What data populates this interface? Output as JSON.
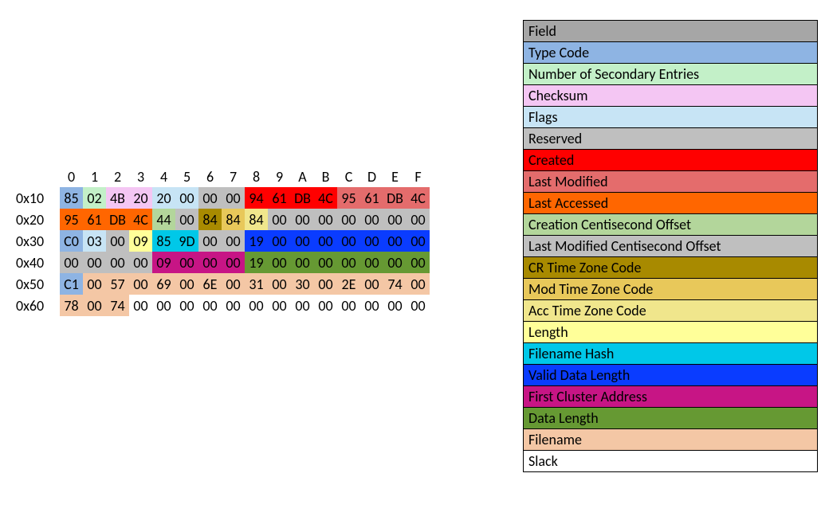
{
  "hex": {
    "col_headers": [
      "0",
      "1",
      "2",
      "3",
      "4",
      "5",
      "6",
      "7",
      "8",
      "9",
      "A",
      "B",
      "C",
      "D",
      "E",
      "F"
    ],
    "rows": [
      {
        "label": "0x10",
        "cells": [
          {
            "v": "85",
            "c": "c-typecode"
          },
          {
            "v": "02",
            "c": "c-numse"
          },
          {
            "v": "4B",
            "c": "c-checksum"
          },
          {
            "v": "20",
            "c": "c-checksum"
          },
          {
            "v": "20",
            "c": "c-flags"
          },
          {
            "v": "00",
            "c": "c-flags"
          },
          {
            "v": "00",
            "c": "c-reserved"
          },
          {
            "v": "00",
            "c": "c-reserved"
          },
          {
            "v": "94",
            "c": "c-created"
          },
          {
            "v": "61",
            "c": "c-created"
          },
          {
            "v": "DB",
            "c": "c-created"
          },
          {
            "v": "4C",
            "c": "c-created"
          },
          {
            "v": "95",
            "c": "c-lastmod"
          },
          {
            "v": "61",
            "c": "c-lastmod"
          },
          {
            "v": "DB",
            "c": "c-lastmod"
          },
          {
            "v": "4C",
            "c": "c-lastmod"
          }
        ]
      },
      {
        "label": "0x20",
        "cells": [
          {
            "v": "95",
            "c": "c-lastacc"
          },
          {
            "v": "61",
            "c": "c-lastacc"
          },
          {
            "v": "DB",
            "c": "c-lastacc"
          },
          {
            "v": "4C",
            "c": "c-lastacc"
          },
          {
            "v": "44",
            "c": "c-crcenti"
          },
          {
            "v": "00",
            "c": "c-lmcenti"
          },
          {
            "v": "84",
            "c": "c-crtz"
          },
          {
            "v": "84",
            "c": "c-modtz"
          },
          {
            "v": "84",
            "c": "c-acctz"
          },
          {
            "v": "00",
            "c": "c-reserved"
          },
          {
            "v": "00",
            "c": "c-reserved"
          },
          {
            "v": "00",
            "c": "c-reserved"
          },
          {
            "v": "00",
            "c": "c-reserved"
          },
          {
            "v": "00",
            "c": "c-reserved"
          },
          {
            "v": "00",
            "c": "c-reserved"
          },
          {
            "v": "00",
            "c": "c-reserved"
          }
        ]
      },
      {
        "label": "0x30",
        "cells": [
          {
            "v": "C0",
            "c": "c-typecode"
          },
          {
            "v": "03",
            "c": "c-flags"
          },
          {
            "v": "00",
            "c": "c-reserved"
          },
          {
            "v": "09",
            "c": "c-length"
          },
          {
            "v": "85",
            "c": "c-fhash"
          },
          {
            "v": "9D",
            "c": "c-fhash"
          },
          {
            "v": "00",
            "c": "c-reserved"
          },
          {
            "v": "00",
            "c": "c-reserved"
          },
          {
            "v": "19",
            "c": "c-vdl"
          },
          {
            "v": "00",
            "c": "c-vdl"
          },
          {
            "v": "00",
            "c": "c-vdl"
          },
          {
            "v": "00",
            "c": "c-vdl"
          },
          {
            "v": "00",
            "c": "c-vdl"
          },
          {
            "v": "00",
            "c": "c-vdl"
          },
          {
            "v": "00",
            "c": "c-vdl"
          },
          {
            "v": "00",
            "c": "c-vdl"
          }
        ]
      },
      {
        "label": "0x40",
        "cells": [
          {
            "v": "00",
            "c": "c-reserved"
          },
          {
            "v": "00",
            "c": "c-reserved"
          },
          {
            "v": "00",
            "c": "c-reserved"
          },
          {
            "v": "00",
            "c": "c-reserved"
          },
          {
            "v": "09",
            "c": "c-fca"
          },
          {
            "v": "00",
            "c": "c-fca"
          },
          {
            "v": "00",
            "c": "c-fca"
          },
          {
            "v": "00",
            "c": "c-fca"
          },
          {
            "v": "19",
            "c": "c-datalen"
          },
          {
            "v": "00",
            "c": "c-datalen"
          },
          {
            "v": "00",
            "c": "c-datalen"
          },
          {
            "v": "00",
            "c": "c-datalen"
          },
          {
            "v": "00",
            "c": "c-datalen"
          },
          {
            "v": "00",
            "c": "c-datalen"
          },
          {
            "v": "00",
            "c": "c-datalen"
          },
          {
            "v": "00",
            "c": "c-datalen"
          }
        ]
      },
      {
        "label": "0x50",
        "cells": [
          {
            "v": "C1",
            "c": "c-typecode"
          },
          {
            "v": "00",
            "c": "c-fname"
          },
          {
            "v": "57",
            "c": "c-fname"
          },
          {
            "v": "00",
            "c": "c-fname"
          },
          {
            "v": "69",
            "c": "c-fname"
          },
          {
            "v": "00",
            "c": "c-fname"
          },
          {
            "v": "6E",
            "c": "c-fname"
          },
          {
            "v": "00",
            "c": "c-fname"
          },
          {
            "v": "31",
            "c": "c-fname"
          },
          {
            "v": "00",
            "c": "c-fname"
          },
          {
            "v": "30",
            "c": "c-fname"
          },
          {
            "v": "00",
            "c": "c-fname"
          },
          {
            "v": "2E",
            "c": "c-fname"
          },
          {
            "v": "00",
            "c": "c-fname"
          },
          {
            "v": "74",
            "c": "c-fname"
          },
          {
            "v": "00",
            "c": "c-fname"
          }
        ]
      },
      {
        "label": "0x60",
        "cells": [
          {
            "v": "78",
            "c": "c-fname"
          },
          {
            "v": "00",
            "c": "c-fname"
          },
          {
            "v": "74",
            "c": "c-fname"
          },
          {
            "v": "00",
            "c": "c-slack"
          },
          {
            "v": "00",
            "c": "c-slack"
          },
          {
            "v": "00",
            "c": "c-slack"
          },
          {
            "v": "00",
            "c": "c-slack"
          },
          {
            "v": "00",
            "c": "c-slack"
          },
          {
            "v": "00",
            "c": "c-slack"
          },
          {
            "v": "00",
            "c": "c-slack"
          },
          {
            "v": "00",
            "c": "c-slack"
          },
          {
            "v": "00",
            "c": "c-slack"
          },
          {
            "v": "00",
            "c": "c-slack"
          },
          {
            "v": "00",
            "c": "c-slack"
          },
          {
            "v": "00",
            "c": "c-slack"
          },
          {
            "v": "00",
            "c": "c-slack"
          }
        ]
      }
    ]
  },
  "legend": [
    {
      "label": "Field",
      "c": "c-field"
    },
    {
      "label": "Type Code",
      "c": "c-typecode"
    },
    {
      "label": "Number of Secondary Entries",
      "c": "c-numse"
    },
    {
      "label": "Checksum",
      "c": "c-checksum"
    },
    {
      "label": "Flags",
      "c": "c-flags"
    },
    {
      "label": "Reserved",
      "c": "c-reserved"
    },
    {
      "label": "Created",
      "c": "c-created"
    },
    {
      "label": "Last Modified",
      "c": "c-lastmod"
    },
    {
      "label": "Last Accessed",
      "c": "c-lastacc"
    },
    {
      "label": "Creation Centisecond Offset",
      "c": "c-crcenti"
    },
    {
      "label": "Last Modified Centisecond Offset",
      "c": "c-lmcenti"
    },
    {
      "label": "CR Time Zone Code",
      "c": "c-crtz"
    },
    {
      "label": "Mod Time Zone Code",
      "c": "c-modtz"
    },
    {
      "label": "Acc Time Zone Code",
      "c": "c-acctz"
    },
    {
      "label": "Length",
      "c": "c-length"
    },
    {
      "label": "Filename Hash",
      "c": "c-fhash"
    },
    {
      "label": "Valid Data Length",
      "c": "c-vdl"
    },
    {
      "label": "First Cluster Address",
      "c": "c-fca"
    },
    {
      "label": "Data Length",
      "c": "c-datalen"
    },
    {
      "label": "Filename",
      "c": "c-fname"
    },
    {
      "label": "Slack",
      "c": "c-slack"
    }
  ]
}
